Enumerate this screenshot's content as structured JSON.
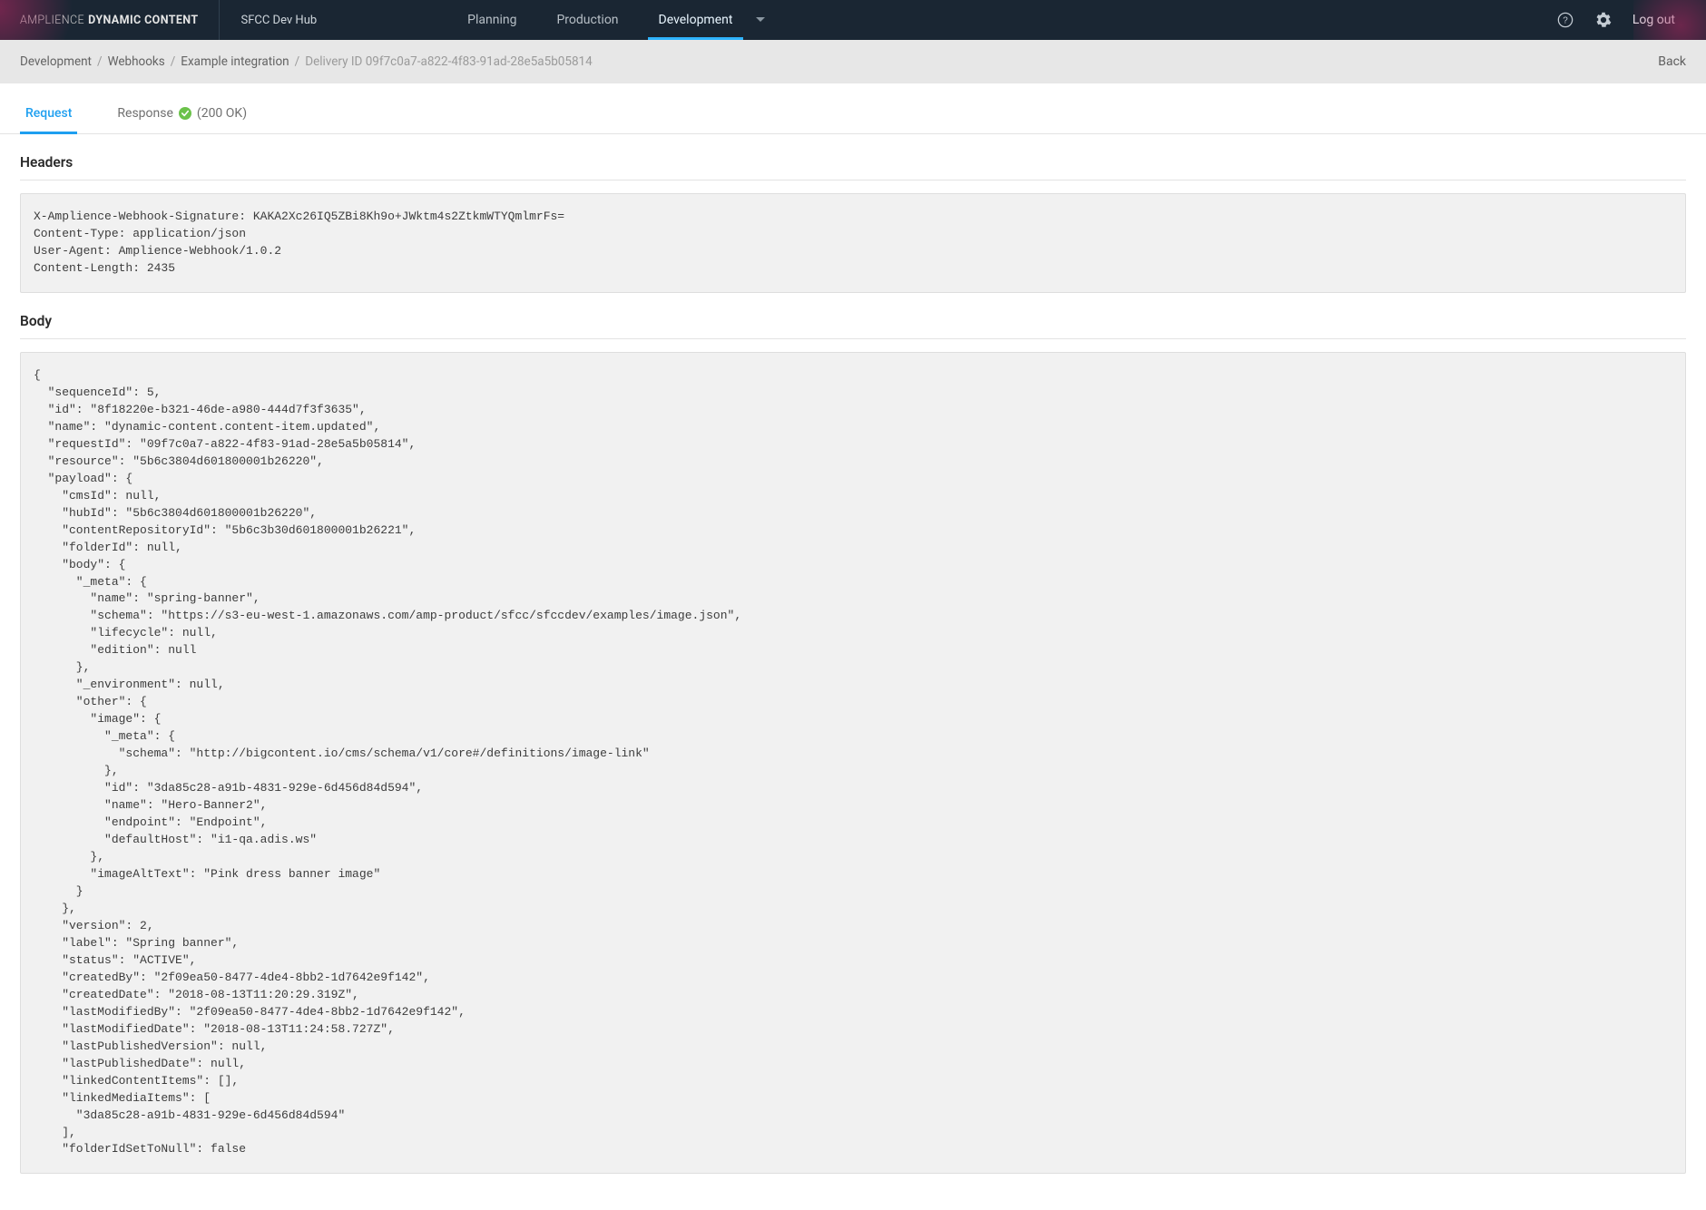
{
  "brand": {
    "left": "AMPLIENCE",
    "right": "DYNAMIC CONTENT"
  },
  "hub_name": "SFCC Dev Hub",
  "top_tabs": {
    "planning": "Planning",
    "production": "Production",
    "development": "Development"
  },
  "logout": "Log out",
  "breadcrumb": {
    "items": [
      "Development",
      "Webhooks",
      "Example integration"
    ],
    "tail": "Delivery ID 09f7c0a7-a822-4f83-91ad-28e5a5b05814",
    "back": "Back"
  },
  "subtabs": {
    "request": "Request",
    "response": "Response",
    "status": "(200 OK)"
  },
  "sections": {
    "headers_title": "Headers",
    "body_title": "Body"
  },
  "headers_code": "X-Amplience-Webhook-Signature: KAKA2Xc26IQ5ZBi8Kh9o+JWktm4s2ZtkmWTYQmlmrFs=\nContent-Type: application/json\nUser-Agent: Amplience-Webhook/1.0.2\nContent-Length: 2435",
  "body_code": "{\n  \"sequenceId\": 5,\n  \"id\": \"8f18220e-b321-46de-a980-444d7f3f3635\",\n  \"name\": \"dynamic-content.content-item.updated\",\n  \"requestId\": \"09f7c0a7-a822-4f83-91ad-28e5a5b05814\",\n  \"resource\": \"5b6c3804d601800001b26220\",\n  \"payload\": {\n    \"cmsId\": null,\n    \"hubId\": \"5b6c3804d601800001b26220\",\n    \"contentRepositoryId\": \"5b6c3b30d601800001b26221\",\n    \"folderId\": null,\n    \"body\": {\n      \"_meta\": {\n        \"name\": \"spring-banner\",\n        \"schema\": \"https://s3-eu-west-1.amazonaws.com/amp-product/sfcc/sfccdev/examples/image.json\",\n        \"lifecycle\": null,\n        \"edition\": null\n      },\n      \"_environment\": null,\n      \"other\": {\n        \"image\": {\n          \"_meta\": {\n            \"schema\": \"http://bigcontent.io/cms/schema/v1/core#/definitions/image-link\"\n          },\n          \"id\": \"3da85c28-a91b-4831-929e-6d456d84d594\",\n          \"name\": \"Hero-Banner2\",\n          \"endpoint\": \"Endpoint\",\n          \"defaultHost\": \"i1-qa.adis.ws\"\n        },\n        \"imageAltText\": \"Pink dress banner image\"\n      }\n    },\n    \"version\": 2,\n    \"label\": \"Spring banner\",\n    \"status\": \"ACTIVE\",\n    \"createdBy\": \"2f09ea50-8477-4de4-8bb2-1d7642e9f142\",\n    \"createdDate\": \"2018-08-13T11:20:29.319Z\",\n    \"lastModifiedBy\": \"2f09ea50-8477-4de4-8bb2-1d7642e9f142\",\n    \"lastModifiedDate\": \"2018-08-13T11:24:58.727Z\",\n    \"lastPublishedVersion\": null,\n    \"lastPublishedDate\": null,\n    \"linkedContentItems\": [],\n    \"linkedMediaItems\": [\n      \"3da85c28-a91b-4831-929e-6d456d84d594\"\n    ],\n    \"folderIdSetToNull\": false"
}
